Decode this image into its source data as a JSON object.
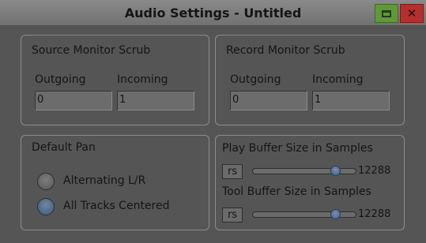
{
  "window": {
    "title": "Audio Settings - Untitled"
  },
  "source_monitor_scrub": {
    "title": "Source Monitor Scrub",
    "outgoing_label": "Outgoing",
    "outgoing_value": "0",
    "incoming_label": "Incoming",
    "incoming_value": "1"
  },
  "record_monitor_scrub": {
    "title": "Record Monitor Scrub",
    "outgoing_label": "Outgoing",
    "outgoing_value": "0",
    "incoming_label": "Incoming",
    "incoming_value": "1"
  },
  "default_pan": {
    "title": "Default Pan",
    "options": [
      {
        "label": "Alternating L/R",
        "selected": false
      },
      {
        "label": "All Tracks Centered",
        "selected": true
      }
    ]
  },
  "buffers": {
    "play": {
      "label": "Play Buffer Size in Samples",
      "reset_label": "rs",
      "value": "12288",
      "slider_fraction": 0.84
    },
    "tool": {
      "label": "Tool Buffer Size in Samples",
      "reset_label": "rs",
      "value": "12288",
      "slider_fraction": 0.84
    }
  },
  "colors": {
    "background": "#555555",
    "maximize_button": "#5f9a3a",
    "close_button": "#b52f2f",
    "selected_radio": "#4f6a8c"
  },
  "icons": {
    "maximize": "maximize-icon",
    "close": "close-icon"
  }
}
